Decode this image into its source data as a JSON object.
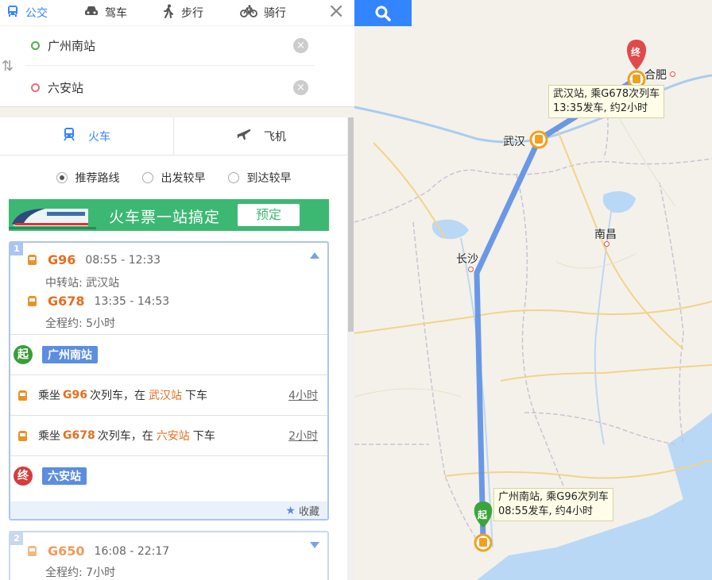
{
  "modes": [
    {
      "label": "公交",
      "icon": "bus-icon",
      "active": true
    },
    {
      "label": "驾车",
      "icon": "car-icon",
      "active": false
    },
    {
      "label": "步行",
      "icon": "walk-icon",
      "active": false
    },
    {
      "label": "骑行",
      "icon": "bike-icon",
      "active": false
    }
  ],
  "route": {
    "origin": "广州南站",
    "destination": "六安站"
  },
  "transport_tabs": [
    {
      "label": "火车",
      "icon": "train-icon",
      "active": true
    },
    {
      "label": "飞机",
      "icon": "plane-icon",
      "active": false
    }
  ],
  "sort_options": [
    {
      "label": "推荐路线",
      "selected": true
    },
    {
      "label": "出发较早",
      "selected": false
    },
    {
      "label": "到达较早",
      "selected": false
    }
  ],
  "banner": {
    "text": "火车票一站搞定",
    "button": "预定"
  },
  "plans": [
    {
      "index": "1",
      "train1": "G96",
      "time1": "08:55 - 12:33",
      "transfer": "中转站: 武汉站",
      "train2": "G678",
      "time2": "13:35 - 14:53",
      "total": "全程约: 5小时",
      "start_station": "广州南站",
      "start_badge": "起",
      "end_station": "六安站",
      "end_badge": "终",
      "steps": [
        {
          "prefix": "乘坐",
          "train": "G96",
          "mid": "次列车，在",
          "station": "武汉站",
          "suffix": "下车",
          "duration": "4小时"
        },
        {
          "prefix": "乘坐",
          "train": "G678",
          "mid": "次列车，在",
          "station": "六安站",
          "suffix": "下车",
          "duration": "2小时"
        }
      ],
      "favorite": "收藏"
    },
    {
      "index": "2",
      "train1": "G650",
      "time1": "16:08 - 22:17",
      "total": "全程约: 7小时"
    }
  ],
  "map": {
    "cities": {
      "wuhan": "武汉",
      "changsha": "长沙",
      "nanchang": "南昌",
      "hefei": "合肥"
    },
    "tooltip_wuhan": {
      "line1": "武汉站, 乘G678次列车",
      "line2": "13:35发车, 约2小时"
    },
    "tooltip_guangzhou": {
      "line1": "广州南站, 乘G96次列车",
      "line2": "08:55发车, 约4小时"
    },
    "start_marker": "起",
    "end_marker": "终",
    "route_color": "#5b8ee6"
  }
}
